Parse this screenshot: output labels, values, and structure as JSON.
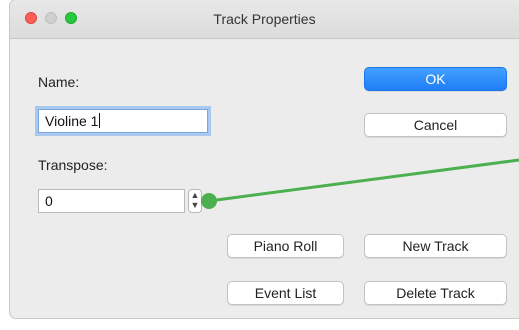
{
  "window": {
    "title": "Track Properties"
  },
  "form": {
    "name_label": "Name:",
    "name_value": "Violine 1",
    "transpose_label": "Transpose:",
    "transpose_value": "0"
  },
  "buttons": {
    "ok": "OK",
    "cancel": "Cancel",
    "piano_roll": "Piano Roll",
    "new_track": "New Track",
    "event_list": "Event List",
    "delete_track": "Delete Track"
  },
  "icons": {
    "stepper_up": "▲",
    "stepper_down": "▼"
  },
  "colors": {
    "accent": "#1f7ef6",
    "connector": "#4caf50"
  }
}
